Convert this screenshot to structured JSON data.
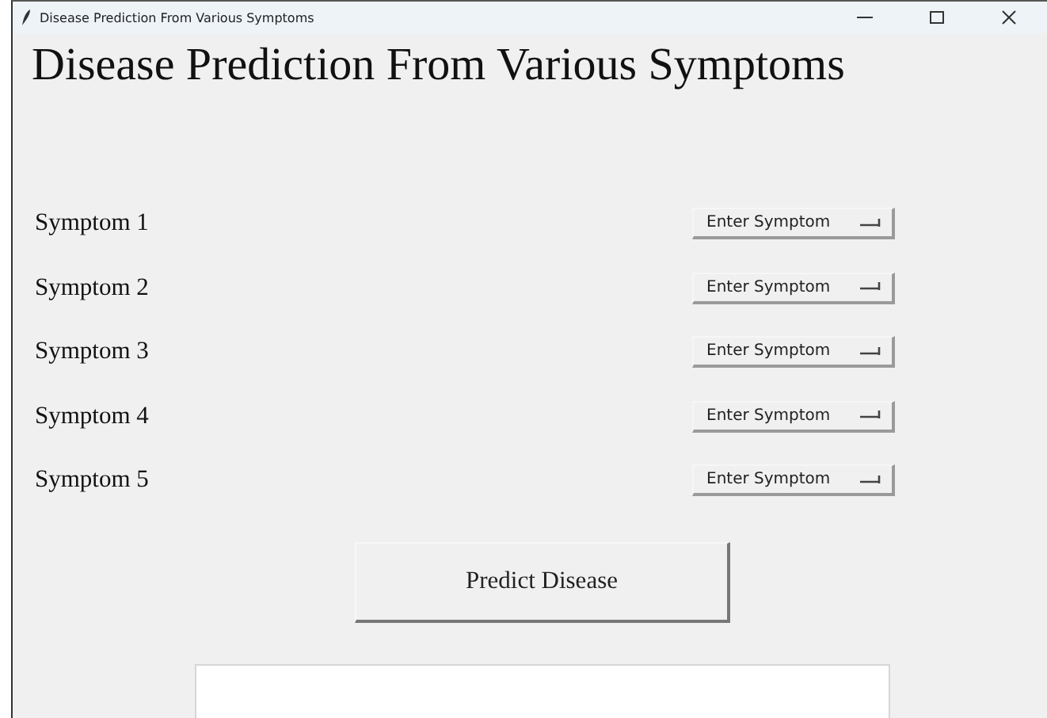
{
  "window": {
    "title": "Disease Prediction From Various Symptoms"
  },
  "heading": "Disease Prediction From Various Symptoms",
  "symptoms": [
    {
      "label": "Symptom 1",
      "dropdown": "Enter Symptom"
    },
    {
      "label": "Symptom 2",
      "dropdown": "Enter Symptom"
    },
    {
      "label": "Symptom 3",
      "dropdown": "Enter Symptom"
    },
    {
      "label": "Symptom 4",
      "dropdown": "Enter Symptom"
    },
    {
      "label": "Symptom 5",
      "dropdown": "Enter Symptom"
    }
  ],
  "predict_button": "Predict Disease",
  "result_box": {
    "kind": "text"
  }
}
